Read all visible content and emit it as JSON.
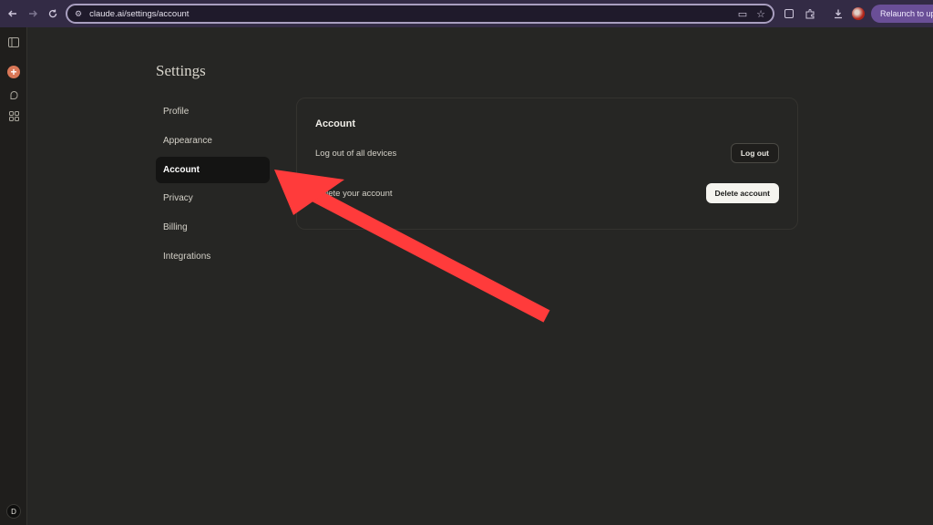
{
  "browser": {
    "url": "claude.ai/settings/account",
    "relaunch_label": "Relaunch to upd",
    "profile_color": "#b02418"
  },
  "rail": {
    "avatar_initial": "D",
    "accent": "#d97757"
  },
  "settings": {
    "title": "Settings",
    "nav": [
      {
        "label": "Profile"
      },
      {
        "label": "Appearance"
      },
      {
        "label": "Account",
        "active": true
      },
      {
        "label": "Privacy"
      },
      {
        "label": "Billing"
      },
      {
        "label": "Integrations"
      }
    ],
    "account": {
      "heading": "Account",
      "logout_all_label": "Log out of all devices",
      "logout_button": "Log out",
      "delete_label": "Delete your account",
      "delete_button": "Delete account"
    }
  },
  "annotation": {
    "arrow_color": "#ff3b3b"
  }
}
